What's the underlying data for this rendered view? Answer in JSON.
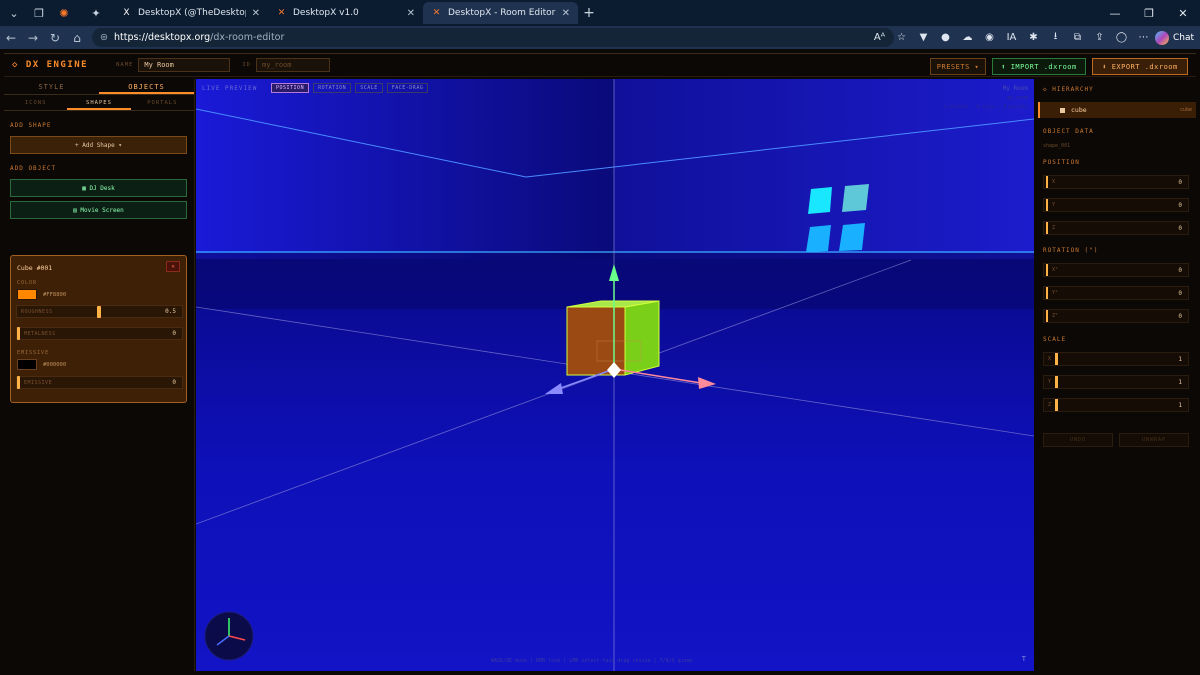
{
  "browser": {
    "tabs": [
      {
        "title": "DesktopX (@TheDesktopX) / X",
        "favicon": "X"
      },
      {
        "title": "DesktopX v1.0",
        "favicon": "✕"
      },
      {
        "title": "DesktopX - Room Editor",
        "favicon": "✕",
        "active": true
      }
    ],
    "url_host": "https://desktopx.org",
    "url_path": "/dx-room-editor",
    "chat_label": "Chat"
  },
  "header": {
    "logo": "◇ DX ENGINE",
    "name_label": "NAME",
    "name_value": "My Room",
    "id_label": "ID",
    "id_placeholder": "my_room",
    "presets": "PRESETS ▾",
    "import": "⬆ IMPORT .dxroom",
    "export": "⬇ EXPORT .dxroom"
  },
  "left": {
    "tabs": [
      "STYLE",
      "OBJECTS"
    ],
    "subtabs": [
      "ICONS",
      "SHAPES",
      "PORTALS"
    ],
    "add_shape_section": "ADD SHAPE",
    "add_shape_btn": "+ Add Shape ▾",
    "add_object_section": "ADD OBJECT",
    "dj_desk": "▦ DJ Desk",
    "movie_screen": "▤ Movie Screen",
    "card": {
      "title": "Cube #001",
      "close": "✕",
      "color_label": "COLOR",
      "color_hex": "#FF8800",
      "roughness_label": "ROUGHNESS",
      "roughness_value": "0.5",
      "metalness_label": "METALNESS",
      "metalness_value": "0",
      "emissive_label": "EMISSIVE",
      "emissive_hex": "#000000",
      "emissive_row_label": "EMISSIVE",
      "emissive_value": "0"
    }
  },
  "viewport": {
    "live_preview": "LIVE PREVIEW",
    "modes": [
      "POSITION",
      "ROTATION",
      "SCALE",
      "FACE-DRAG"
    ],
    "room_name": "My Room",
    "room_id": "my_room",
    "stats": "1 objects · 0 icons · 0 portals",
    "hint": "WASD/QE move | RMB look | LMB select·face drag resize | T/R/S gizmo",
    "corner": "T"
  },
  "right": {
    "hierarchy": "◇ HIERARCHY",
    "item_name": "cube",
    "item_type": "cube",
    "object_data": "OBJECT DATA",
    "object_id": "shape_001",
    "position": "POSITION",
    "pos": [
      {
        "l": "X",
        "v": "0"
      },
      {
        "l": "Y",
        "v": "0"
      },
      {
        "l": "Z",
        "v": "0"
      }
    ],
    "rotation": "ROTATION (°)",
    "rot": [
      {
        "l": "X°",
        "v": "0"
      },
      {
        "l": "Y°",
        "v": "0"
      },
      {
        "l": "Z°",
        "v": "0"
      }
    ],
    "scale": "SCALE",
    "scl": [
      {
        "l": "X",
        "v": "1"
      },
      {
        "l": "Y",
        "v": "1"
      },
      {
        "l": "Z",
        "v": "1"
      }
    ],
    "undo": "UNDO",
    "unwrap": "UNWRAP"
  },
  "colors": {
    "accent": "#ff8c2a",
    "cube": "#ff8800",
    "floor": "#0e10b8"
  }
}
